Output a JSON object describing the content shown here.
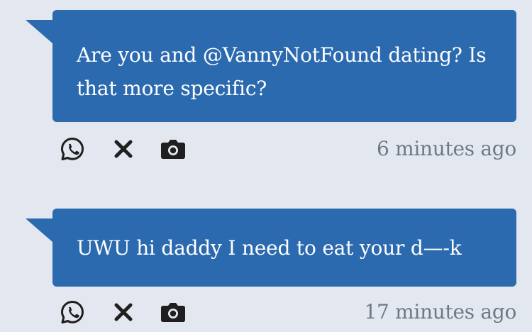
{
  "messages": [
    {
      "text": "Are you and @VannyNotFound dating? Is that more specific?",
      "time": "6 minutes ago"
    },
    {
      "text": "UWU hi daddy I need to eat your d—-k",
      "time": "17 minutes ago"
    }
  ],
  "icons": {
    "share_whatsapp": "whatsapp-icon",
    "share_x": "x-icon",
    "share_camera": "camera-icon"
  },
  "colors": {
    "background": "#e3e7f0",
    "bubble": "#2c6aaf",
    "bubble_text": "#ffffff",
    "icon": "#1f1f1f",
    "timestamp": "#6e7888"
  }
}
